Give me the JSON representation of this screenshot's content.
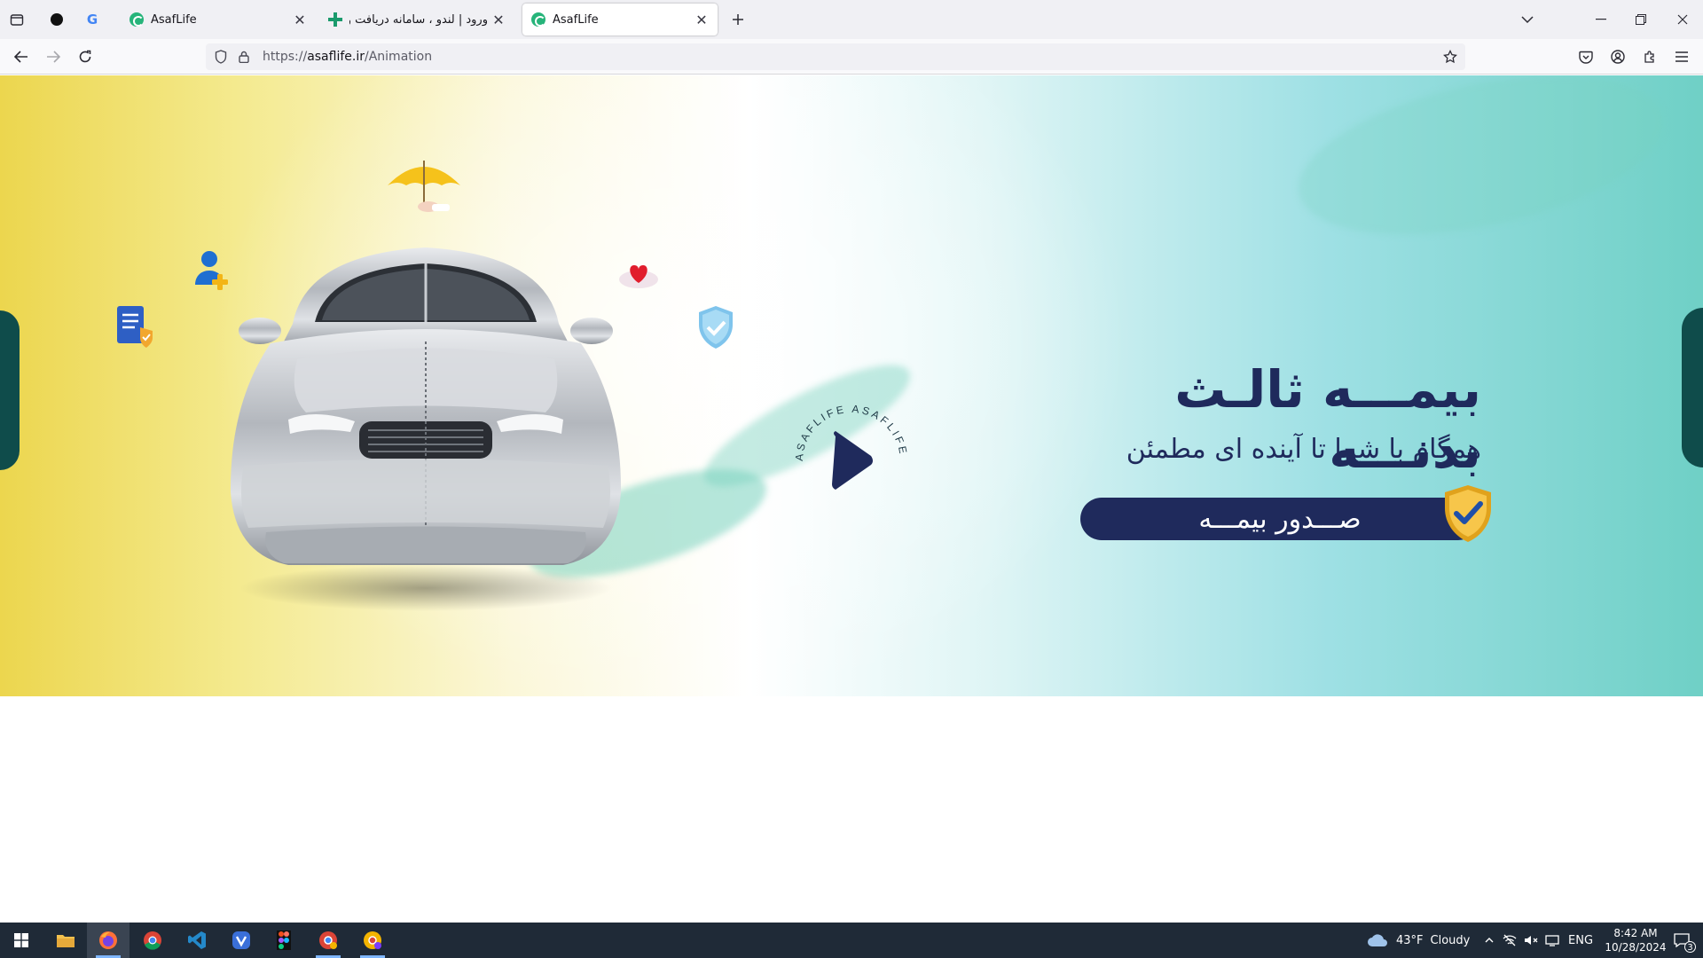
{
  "browser": {
    "tabs": [
      {
        "title": "AsafLife",
        "active": false
      },
      {
        "title": "ورود | لندو ، سامانه دریافت وام و",
        "active": false
      },
      {
        "title": "AsafLife",
        "active": true
      }
    ],
    "url": {
      "prefix": "https://",
      "host": "asaflife.ir",
      "path": "/Animation"
    }
  },
  "hero": {
    "title": "بیمـــه ثالـث بدنـــه",
    "subtitle": "همگام با شما تا آینده ای مطمئن",
    "cta_label": "صـــدور بیمـــه",
    "play_badge_text": "ASAFLIFE ASAFLIFE",
    "colors": {
      "navy": "#1f2a5c",
      "teal": "#6fd0c6",
      "yellow": "#ecd64e"
    }
  },
  "taskbar": {
    "weather": {
      "temp": "43°F",
      "condition": "Cloudy"
    },
    "language": "ENG",
    "time": "8:42 AM",
    "date": "10/28/2024",
    "notifications": "3"
  }
}
